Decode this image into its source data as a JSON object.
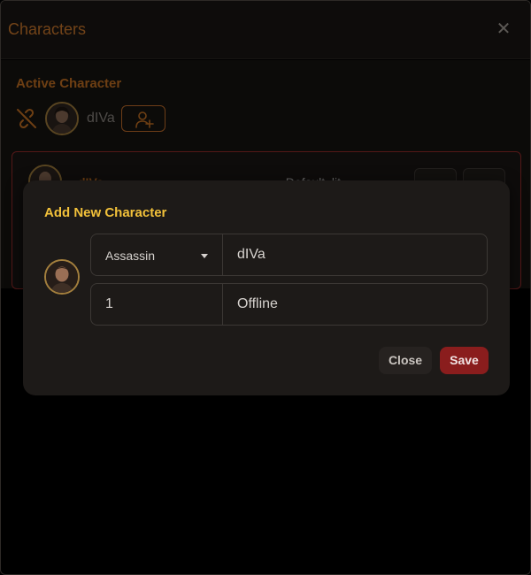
{
  "window": {
    "title": "Characters",
    "close_icon": "close-icon"
  },
  "active": {
    "label": "Active Character",
    "name": "dIVa",
    "unlink_icon": "unlink-icon",
    "add_icon": "add-user-icon"
  },
  "card": {
    "name": "dIVa",
    "status": "• Default, lit",
    "button1_icon": "unlink-icon",
    "button2_icon": "trash-icon"
  },
  "modal": {
    "title": "Add New Character",
    "class_value": "Assassin",
    "name_value": "dIVa",
    "level_value": "1",
    "mode_value": "Offline",
    "close_label": "Close",
    "save_label": "Save"
  },
  "colors": {
    "accent": "#cf7a2c",
    "modal_title": "#f2c13a",
    "danger": "#8a1d1d",
    "card_border": "#9a2c2c"
  }
}
